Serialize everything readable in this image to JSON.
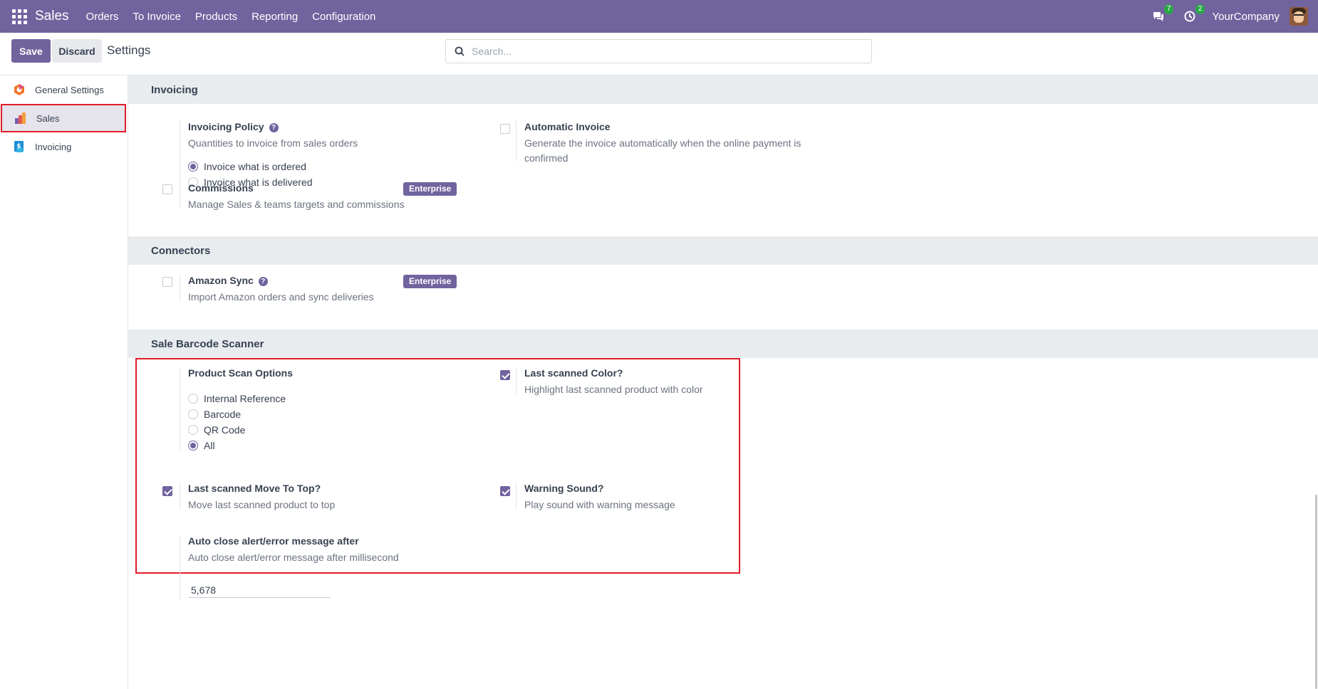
{
  "navbar": {
    "app_name": "Sales",
    "menu": [
      "Orders",
      "To Invoice",
      "Products",
      "Reporting",
      "Configuration"
    ],
    "messages_count": "7",
    "activities_count": "2",
    "company": "YourCompany"
  },
  "control": {
    "save_label": "Save",
    "discard_label": "Discard",
    "title": "Settings",
    "search_placeholder": "Search..."
  },
  "sidebar": {
    "items": [
      {
        "label": "General Settings",
        "icon": "odoo-icon"
      },
      {
        "label": "Sales",
        "icon": "sales-icon",
        "active": true
      },
      {
        "label": "Invoicing",
        "icon": "invoicing-icon"
      }
    ]
  },
  "sections": {
    "invoicing": {
      "header": "Invoicing",
      "policy_title": "Invoicing Policy",
      "policy_desc": "Quantities to invoice from sales orders",
      "policy_options": [
        "Invoice what is ordered",
        "Invoice what is delivered"
      ],
      "policy_selected": 0,
      "auto_invoice_title": "Automatic Invoice",
      "auto_invoice_desc": "Generate the invoice automatically when the online payment is confirmed",
      "commissions_title": "Commissions",
      "commissions_desc": "Manage Sales & teams targets and commissions",
      "enterprise_badge": "Enterprise"
    },
    "connectors": {
      "header": "Connectors",
      "amazon_title": "Amazon Sync",
      "amazon_desc": "Import Amazon orders and sync deliveries",
      "enterprise_badge": "Enterprise"
    },
    "barcode": {
      "header": "Sale Barcode Scanner",
      "scan_options_title": "Product Scan Options",
      "scan_options": [
        "Internal Reference",
        "Barcode",
        "QR Code",
        "All"
      ],
      "scan_selected": 3,
      "last_color_title": "Last scanned Color?",
      "last_color_desc": "Highlight last scanned product with color",
      "last_color_checked": true,
      "move_top_title": "Last scanned Move To Top?",
      "move_top_desc": "Move last scanned product to top",
      "move_top_checked": true,
      "warning_title": "Warning Sound?",
      "warning_desc": "Play sound with warning message",
      "warning_checked": true,
      "autoclose_title": "Auto close alert/error message after",
      "autoclose_desc": "Auto close alert/error message after millisecond",
      "autoclose_value": "5,678"
    }
  },
  "colors": {
    "brand": "#71639e",
    "highlight": "#e11d2a"
  }
}
